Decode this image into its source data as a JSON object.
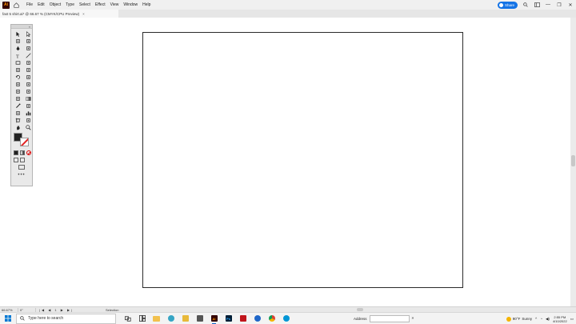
{
  "app": {
    "logo_text": "Ai",
    "menu": [
      "File",
      "Edit",
      "Object",
      "Type",
      "Select",
      "Effect",
      "View",
      "Window",
      "Help"
    ],
    "share_label": "Share",
    "window_controls": [
      "—",
      "❐",
      "✕"
    ]
  },
  "document": {
    "tab_title": "fast 5 shirt.ai* @ 66.67 % (CMYK/CPU Preview)",
    "tab_close": "×"
  },
  "toolbar": {
    "tools": [
      "selection-tool",
      "direct-selection-tool",
      "magic-wand-tool",
      "lasso-tool",
      "pen-tool",
      "curvature-tool",
      "type-tool",
      "line-segment-tool",
      "rectangle-tool",
      "paintbrush-tool",
      "shaper-tool",
      "eraser-tool",
      "rotate-tool",
      "scale-tool",
      "width-tool",
      "free-transform-tool",
      "shape-builder-tool",
      "perspective-grid-tool",
      "mesh-tool",
      "gradient-tool",
      "eyedropper-tool",
      "blend-tool",
      "symbol-sprayer-tool",
      "column-graph-tool",
      "artboard-tool",
      "slice-tool",
      "hand-tool",
      "zoom-tool"
    ],
    "more_label": "•••"
  },
  "statusbar": {
    "zoom": "66.67%",
    "rotation": "0°",
    "nav": "|◀ ◀ 1 ▶ ▶|",
    "tool_name": "Selection"
  },
  "taskbar": {
    "search_placeholder": "Type here to search",
    "address_label": "Address",
    "weather_temp": "90°F",
    "weather_text": "Sunny",
    "time": "2:55 PM",
    "date": "4/10/2022"
  },
  "colors": {
    "accent": "#1473e6",
    "illustrator_bg": "#330000",
    "illustrator_fg": "#ff9a00"
  }
}
